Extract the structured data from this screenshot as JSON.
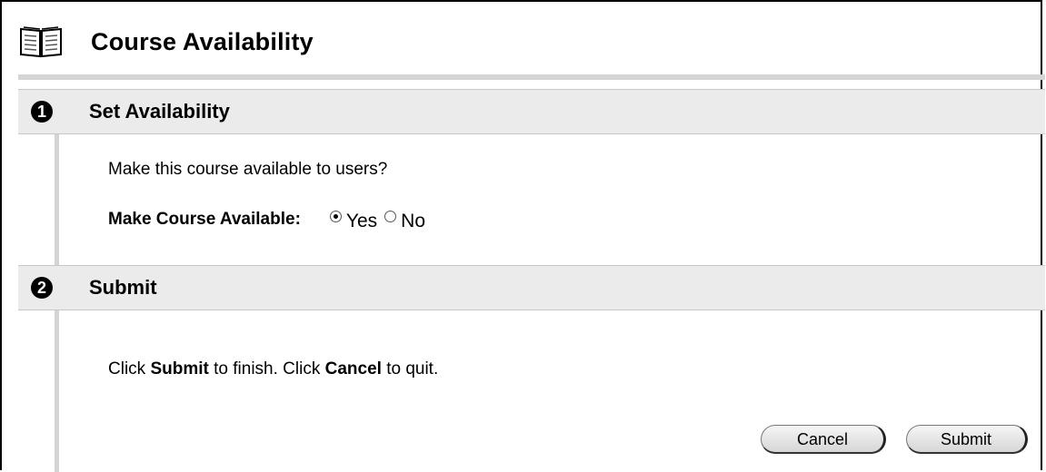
{
  "page": {
    "title": "Course Availability",
    "icon": "book-icon"
  },
  "steps": [
    {
      "number": "1",
      "label": "Set Availability",
      "question": "Make this course available to users?",
      "field": {
        "label": "Make Course Available:",
        "options": [
          {
            "label": "Yes",
            "checked": true
          },
          {
            "label": "No",
            "checked": false
          }
        ]
      }
    },
    {
      "number": "2",
      "label": "Submit",
      "instruction": {
        "part1": "Click ",
        "bold1": "Submit",
        "part2": " to finish. Click ",
        "bold2": "Cancel",
        "part3": " to quit."
      }
    }
  ],
  "buttons": {
    "cancel": "Cancel",
    "submit": "Submit"
  },
  "colors": {
    "step_bar": "#ebebeb",
    "rule": "#d4d4d4"
  }
}
